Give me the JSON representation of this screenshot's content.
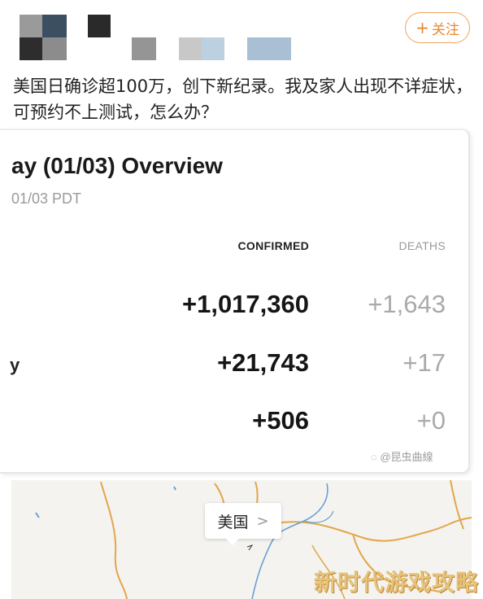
{
  "header": {
    "follow_label": "关注",
    "follow_plus": "+"
  },
  "post": {
    "text": "美国日确诊超100万，创下新纪录。我及家人出现不详症状，可预约不上测试，怎么办？"
  },
  "card": {
    "title": "ay (01/03) Overview",
    "subtitle": "01/03 PDT",
    "columns": {
      "confirmed": "CONFIRMED",
      "deaths": "DEATHS"
    },
    "rows": [
      {
        "label": "",
        "confirmed": "+1,017,360",
        "deaths": "+1,643"
      },
      {
        "label": "y",
        "confirmed": "+21,743",
        "deaths": "+17"
      },
      {
        "label": "",
        "confirmed": "+506",
        "deaths": "+0"
      }
    ]
  },
  "weibo_watermark": "@昆虫曲線",
  "map": {
    "pill_label": "美国",
    "pill_chevron": ">"
  },
  "site_watermark": "新时代游戏攻略",
  "colors": {
    "accent_orange": "#e8892e",
    "map_river": "#6a9fd6",
    "map_border": "#e2a64a",
    "watermark": "#e7c27a"
  }
}
